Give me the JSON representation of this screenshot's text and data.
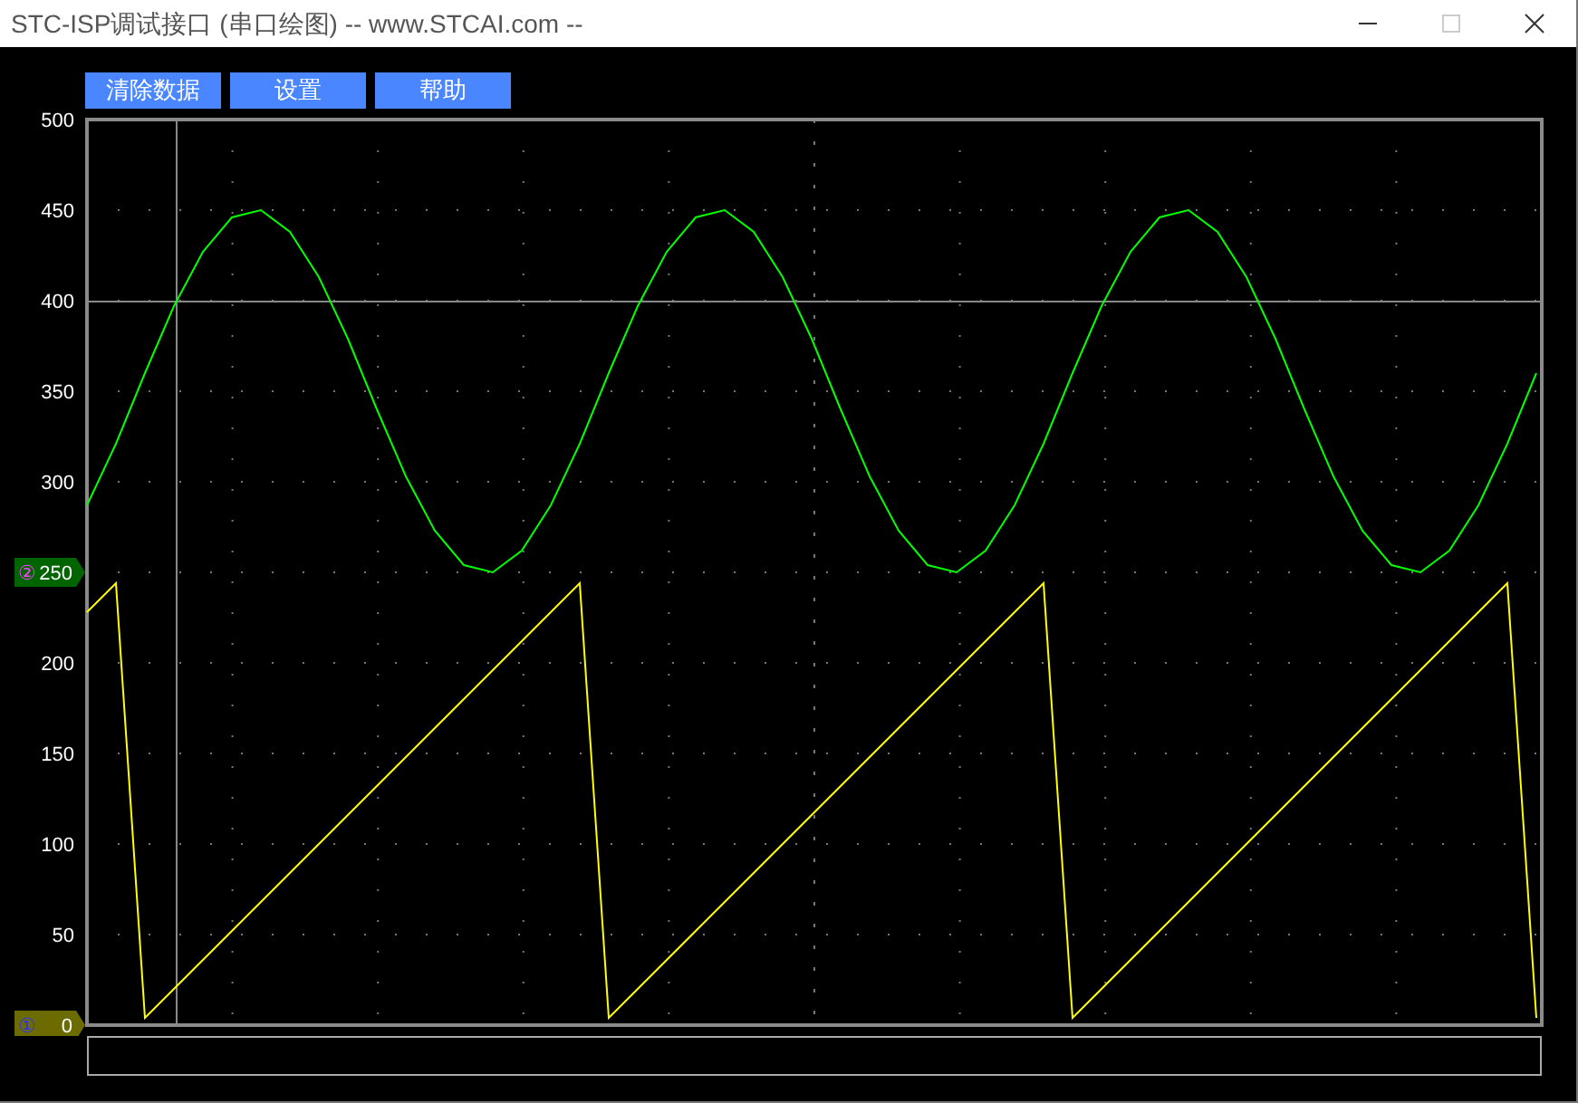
{
  "window": {
    "title": "STC-ISP调试接口 (串口绘图) -- www.STCAI.com --"
  },
  "buttons": [
    "清除数据",
    "设置",
    "帮助"
  ],
  "plot": {
    "chart_data": {
      "type": "line",
      "grid": true,
      "ylim": [
        0,
        500
      ],
      "yticks": [
        50,
        100,
        150,
        200,
        300,
        350,
        400,
        450,
        500
      ],
      "series": [
        {
          "color": "#ffff00",
          "values": [
            228,
            244,
            4,
            20,
            36,
            52,
            68,
            84,
            100,
            116,
            132,
            148,
            164,
            180,
            196,
            212,
            228,
            244,
            4,
            20,
            36,
            52,
            68,
            84,
            100,
            116,
            132,
            148,
            164,
            180,
            196,
            212,
            228,
            244,
            4,
            20,
            36,
            52,
            68,
            84,
            100,
            116,
            132,
            148,
            164,
            180,
            196,
            212,
            228,
            244,
            4
          ]
        },
        {
          "color": "#00ff00",
          "values": [
            287,
            321,
            360,
            397,
            427,
            446,
            450,
            438,
            413,
            379,
            340,
            303,
            273,
            254,
            250,
            262,
            287,
            321,
            360,
            397,
            427,
            446,
            450,
            438,
            413,
            379,
            340,
            303,
            273,
            254,
            250,
            262,
            287,
            321,
            360,
            397,
            427,
            446,
            450,
            438,
            413,
            379,
            340,
            303,
            273,
            254,
            250,
            262,
            287,
            321,
            360
          ]
        }
      ]
    },
    "channel_tags": [
      {
        "symbol": "②",
        "value": "250",
        "color": "#006400"
      },
      {
        "symbol": "①",
        "value": "0",
        "color": "#6b6b00"
      }
    ]
  }
}
